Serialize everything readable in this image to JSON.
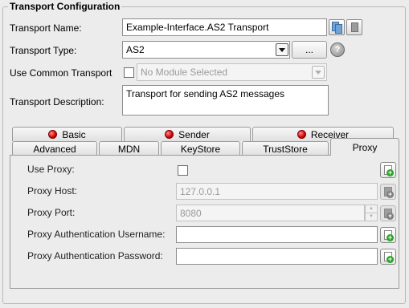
{
  "group_title": "Transport Configuration",
  "transport_name": {
    "label": "Transport Name:",
    "value": "Example-Interface.AS2 Transport"
  },
  "transport_type": {
    "label": "Transport Type:",
    "value": "AS2",
    "browse_label": "..."
  },
  "use_common_transport": {
    "label": "Use Common Transport",
    "placeholder": "No Module Selected"
  },
  "transport_description": {
    "label": "Transport Description:",
    "value": "Transport for sending AS2 messages"
  },
  "tabs_row1": [
    {
      "label": "Basic",
      "status": "error"
    },
    {
      "label": "Sender",
      "status": "error"
    },
    {
      "label": "Receiver",
      "status": "error"
    }
  ],
  "tabs_row2": [
    {
      "label": "Advanced"
    },
    {
      "label": "MDN"
    },
    {
      "label": "KeyStore"
    },
    {
      "label": "TrustStore"
    },
    {
      "label": "Proxy",
      "selected": true
    }
  ],
  "proxy": {
    "use_proxy_label": "Use Proxy:",
    "host_label": "Proxy Host:",
    "host_value": "127.0.0.1",
    "port_label": "Proxy Port:",
    "port_value": "8080",
    "username_label": "Proxy Authentication Username:",
    "password_label": "Proxy Authentication Password:"
  },
  "colors": {
    "error_dot": "#d40000",
    "add_plus": "#2aa52a",
    "window_bg": "#ececec"
  },
  "icons": [
    "copy-icon",
    "document-icon",
    "help-icon",
    "add-value-icon",
    "error-status-icon"
  ]
}
